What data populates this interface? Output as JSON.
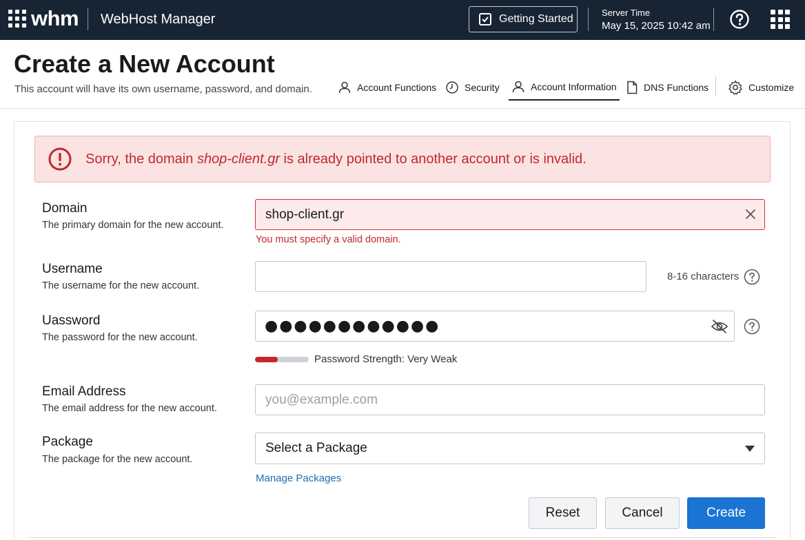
{
  "topbar": {
    "logo": "whm",
    "product_name": "WebHost Manager",
    "getting_started_label": "Getting Started",
    "server_time_label": "Server Time",
    "server_time_value": "May 15, 2025 10:42 am",
    "icons": [
      "grid-menu-icon",
      "getting-started-icon",
      "help-icon",
      "apps-icon"
    ]
  },
  "header": {
    "title": "Create a New Account",
    "subtitle": "This account will have its own username, password, and domain."
  },
  "subnav": {
    "items": [
      {
        "label": "Account Functions",
        "icon": "user-icon"
      },
      {
        "label": "Security",
        "icon": "shield-icon"
      },
      {
        "label": "Account Information",
        "icon": "user-icon",
        "active": true
      },
      {
        "label": "DNS Functions",
        "icon": "document-icon"
      },
      {
        "label": "Customize",
        "icon": "gear-icon"
      }
    ]
  },
  "alert": {
    "prefix": "Sorry, the domain ",
    "domain": "shop-client.gr",
    "suffix": " is already pointed to another account or is invalid."
  },
  "form": {
    "domain": {
      "label": "Domain",
      "help": "The primary domain for the new account.",
      "value": "shop-client.gr",
      "error": "You must specify a valid domain."
    },
    "username": {
      "label": "Username",
      "help": "The username for the new account.",
      "value": "",
      "hint": "8-16 characters"
    },
    "password": {
      "label": "Uassword",
      "help": "The password for the new account.",
      "masked_value": "●●●●●●●●●●●●",
      "strength_label": "Password Strength: Very Weak",
      "strength_fraction": 0.42
    },
    "email": {
      "label": "Email Address",
      "help": "The email address for the new account.",
      "value": "",
      "placeholder": "you@example.com"
    },
    "package": {
      "label": "Package",
      "help": "The package for the new account.",
      "selected": "Select a Package",
      "manage_link": "Manage Packages"
    }
  },
  "actions": {
    "reset": "Reset",
    "cancel": "Cancel",
    "create": "Create"
  },
  "colors": {
    "topbar_bg": "#172433",
    "error": "#c0282d",
    "error_bg": "#fbe3e3",
    "primary": "#1b73d3",
    "link": "#1a6fb5"
  }
}
